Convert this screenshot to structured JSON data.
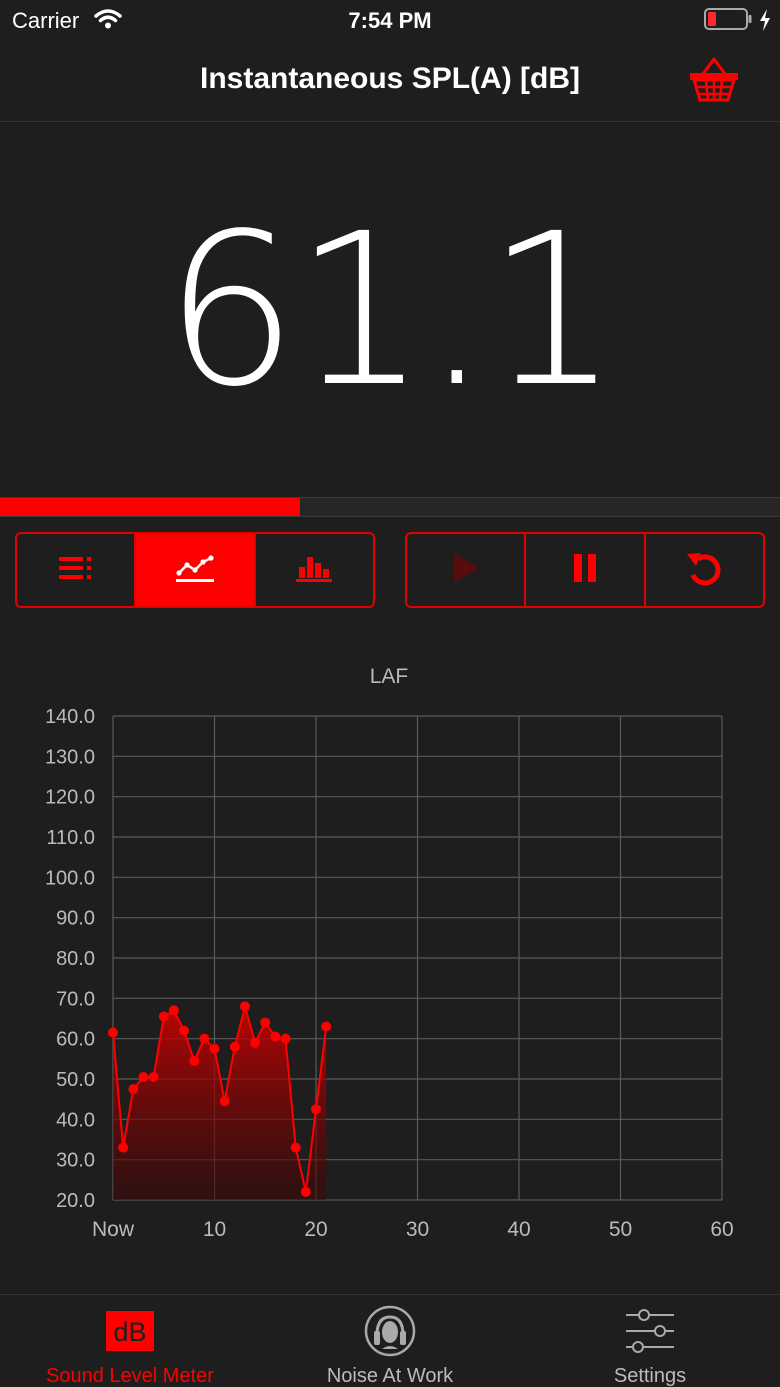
{
  "status_bar": {
    "carrier": "Carrier",
    "time": "7:54 PM"
  },
  "header": {
    "title": "Instantaneous SPL(A) [dB]"
  },
  "meter": {
    "value": "61.1",
    "level_fraction": 0.385
  },
  "view_modes": [
    {
      "name": "list-view",
      "icon": "list-icon",
      "active": false
    },
    {
      "name": "graph-view",
      "icon": "line-chart-icon",
      "active": true
    },
    {
      "name": "histogram-view",
      "icon": "bar-chart-icon",
      "active": false
    }
  ],
  "controls": [
    {
      "name": "play",
      "icon": "play-icon",
      "enabled": false
    },
    {
      "name": "pause",
      "icon": "pause-icon",
      "enabled": true
    },
    {
      "name": "reset",
      "icon": "reset-icon",
      "enabled": true
    }
  ],
  "chart_data": {
    "type": "area",
    "title": "LAF",
    "xlabel": "",
    "ylabel": "",
    "xlim": [
      0,
      60
    ],
    "ylim": [
      20,
      140
    ],
    "x_ticks": [
      {
        "value": 0,
        "label": "Now"
      },
      {
        "value": 10,
        "label": "10"
      },
      {
        "value": 20,
        "label": "20"
      },
      {
        "value": 30,
        "label": "30"
      },
      {
        "value": 40,
        "label": "40"
      },
      {
        "value": 50,
        "label": "50"
      },
      {
        "value": 60,
        "label": "60"
      }
    ],
    "y_ticks": [
      "20.0",
      "30.0",
      "40.0",
      "50.0",
      "60.0",
      "70.0",
      "80.0",
      "90.0",
      "100.0",
      "110.0",
      "120.0",
      "130.0",
      "140.0"
    ],
    "grid": true,
    "color": "#ff0000",
    "series": [
      {
        "x": [
          0,
          1,
          2,
          3,
          4,
          5,
          6,
          7,
          8,
          9,
          10,
          11,
          12,
          13,
          14,
          15,
          16,
          17,
          18,
          19,
          20,
          21
        ],
        "values": [
          61.5,
          33,
          47.5,
          50.5,
          50.5,
          65.5,
          67,
          62,
          54.5,
          60,
          57.5,
          44.5,
          58,
          68,
          59,
          64,
          60.5,
          60,
          33,
          22,
          42.5,
          63
        ]
      }
    ]
  },
  "tabs": [
    {
      "label": "Sound Level Meter",
      "icon": "db-icon",
      "active": true
    },
    {
      "label": "Noise At Work",
      "icon": "headphones-icon",
      "active": false
    },
    {
      "label": "Settings",
      "icon": "sliders-icon",
      "active": false
    }
  ]
}
